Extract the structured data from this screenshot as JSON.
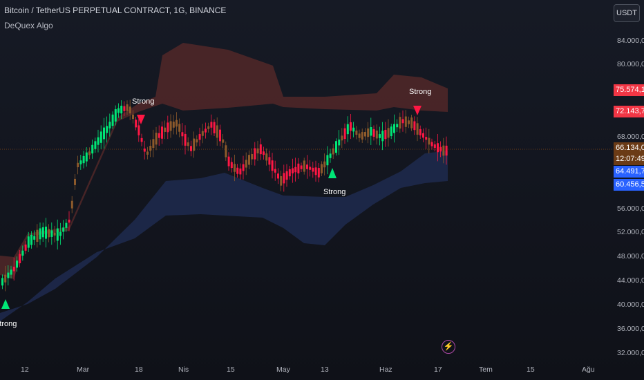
{
  "header": {
    "title": "Bitcoin / TetherUS PERPETUAL CONTRACT, 1G, BINANCE",
    "indicator": "DeQuex Algo"
  },
  "currency_button": "USDT",
  "price_axis": [
    "84.000,0",
    "80.000,0",
    "68.000,0",
    "56.000,0",
    "52.000,0",
    "48.000,0",
    "44.000,0",
    "40.000,0",
    "36.000,0",
    "32.000,0"
  ],
  "price_labels": {
    "upper_band_top": {
      "text": "75.574,1",
      "color": "#f23645"
    },
    "upper_band_bottom": {
      "text": "72.143,7",
      "color": "#f23645"
    },
    "last_price": {
      "text": "66.134,0",
      "color": "#6b3b16"
    },
    "countdown": {
      "text": "12:07:49",
      "color": "#6b3b16"
    },
    "lower_band_top": {
      "text": "64.491,7",
      "color": "#2962ff"
    },
    "lower_band_bottom": {
      "text": "60.456,5",
      "color": "#2962ff"
    }
  },
  "time_axis": [
    "12",
    "Mar",
    "18",
    "Nis",
    "15",
    "May",
    "13",
    "Haz",
    "17",
    "Tem",
    "15",
    "Ağu"
  ],
  "signals": [
    {
      "text": "Strong",
      "type": "buy"
    },
    {
      "text": "Strong",
      "type": "sell"
    },
    {
      "text": "Strong",
      "type": "buy"
    },
    {
      "text": "Strong",
      "type": "sell"
    }
  ],
  "icons": {
    "bolt": "lightning-icon"
  },
  "colors": {
    "bull": "#00e676",
    "bear": "#ff1744",
    "neutral": "#8d5a2b",
    "upper_band": "#5a2a2a",
    "lower_band": "#1e2a4f"
  }
}
